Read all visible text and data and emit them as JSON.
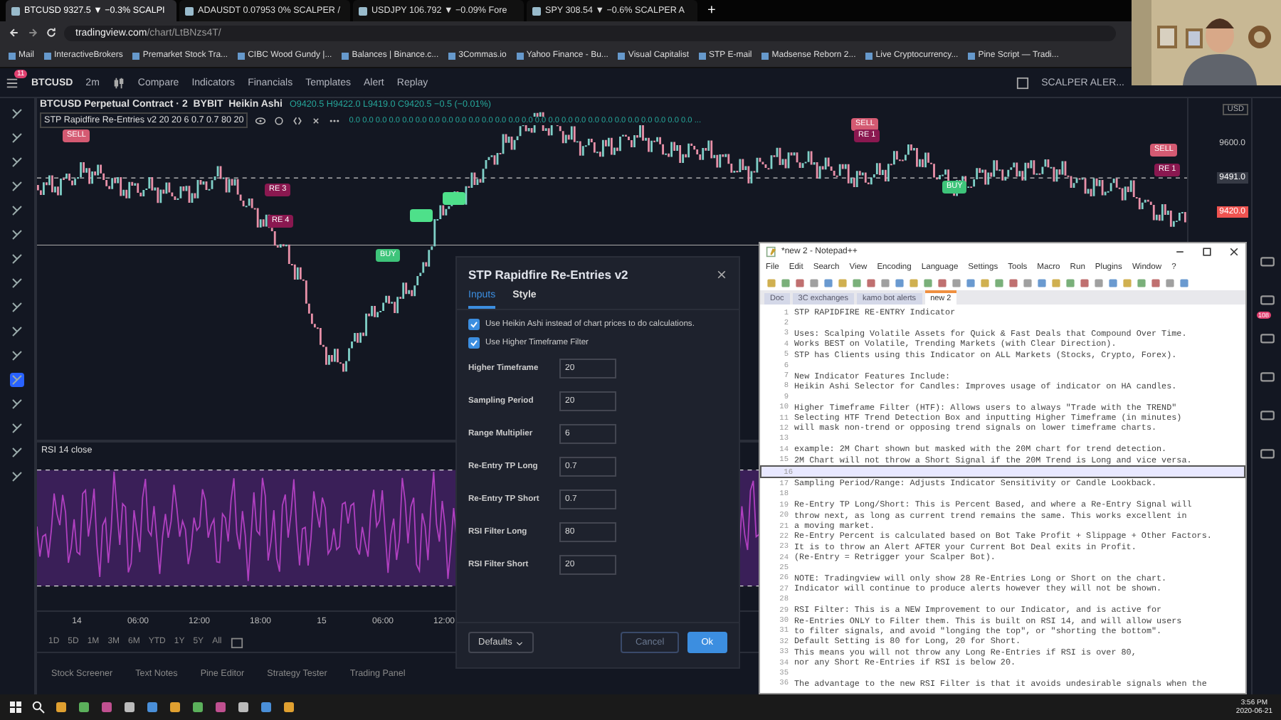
{
  "browser": {
    "tabs": [
      {
        "title": "BTCUSD 9327.5 ▼ −0.3% SCALPI",
        "selected": true
      },
      {
        "title": "ADAUSDT 0.07953 0% SCALPER /",
        "selected": false
      },
      {
        "title": "USDJPY 106.792 ▼ −0.09% Fore",
        "selected": false
      },
      {
        "title": "SPY 308.54 ▼ −0.6% SCALPER A",
        "selected": false
      }
    ],
    "new_tab": "+",
    "url_host": "tradingview.com",
    "url_path": "/chart/LtBNzs4T/",
    "bookmarks": [
      "Mail",
      "InteractiveBrokers",
      "Premarket Stock Tra...",
      "CIBC Wood Gundy |...",
      "Balances | Binance.c...",
      "3Commas.io",
      "Yahoo Finance - Bu...",
      "Visual Capitalist",
      "STP E-mail",
      "Madsense Reborn 2...",
      "Live Cryptocurrency...",
      "Pine Script — Tradi..."
    ]
  },
  "toolbar": {
    "menu_badge": "11",
    "symbol": "BTCUSD",
    "interval": "2m",
    "items": [
      "Compare",
      "Indicators",
      "Financials",
      "Templates",
      "Alert",
      "Replay"
    ],
    "layout": "SCALPER ALER..."
  },
  "chart": {
    "title": "BTCUSD Perpetual Contract · 2  BYBIT  Heikin Ashi",
    "ohlc": "O9420.5 H9422.0 L9419.0 C9420.5 −0.5 (−0.01%)",
    "indicator": "STP Rapidfire Re-Entries v2 20 20 6 0.7 0.7 80 20",
    "indicator_values": "0.0 0.0 0.0 0.0 0.0 0.0 0.0 0.0 0.0 0.0 0.0 0.0 0.0 0.0 0.0 0.0 0.0 0.0 0.0 0.0 0.0 0.0 0.0 0.0 0.0 0.0 ...",
    "signals": [
      {
        "kind": "sell",
        "label": "SELL"
      },
      {
        "kind": "short_reentry",
        "label": "RE 3"
      },
      {
        "kind": "short_reentry",
        "label": "RE 4"
      },
      {
        "kind": "buy",
        "label": "BUY"
      },
      {
        "kind": "long_reentry"
      },
      {
        "kind": "long_reentry"
      },
      {
        "kind": "sell",
        "label": "SELL"
      },
      {
        "kind": "short_reentry",
        "label": "RE 1"
      },
      {
        "kind": "buy",
        "label": "BUY"
      },
      {
        "kind": "sell",
        "label": "SELL"
      },
      {
        "kind": "short_reentry",
        "label": "RE 1"
      }
    ],
    "price_axis": {
      "currency": "USD",
      "labels": [
        {
          "text": "9600.0",
          "kind": "plain"
        },
        {
          "text": "9491.0",
          "kind": "crosshair"
        },
        {
          "text": "9420.0",
          "kind": "last"
        }
      ]
    },
    "rsi_title": "RSI 14 close",
    "time_labels": [
      "14",
      "06:00",
      "12:00",
      "18:00",
      "15",
      "06:00",
      "12:00"
    ],
    "ranges": [
      "1D",
      "5D",
      "1M",
      "3M",
      "6M",
      "YTD",
      "1Y",
      "5Y",
      "All"
    ]
  },
  "bottom_tabs": [
    "Stock Screener",
    "Text Notes",
    "Pine Editor",
    "Strategy Tester",
    "Trading Panel"
  ],
  "sidebar_badge": "108",
  "dialog": {
    "title": "STP Rapidfire Re-Entries v2",
    "tabs": [
      {
        "label": "Inputs",
        "selected": true
      },
      {
        "label": "Style",
        "selected": false
      }
    ],
    "checkboxes": [
      {
        "label": "Use Heikin Ashi instead of chart prices to do calculations.",
        "checked": true
      },
      {
        "label": "Use Higher Timeframe Filter",
        "checked": true
      }
    ],
    "fields": [
      {
        "label": "Higher Timeframe",
        "value": "20"
      },
      {
        "label": "Sampling Period",
        "value": "20"
      },
      {
        "label": "Range Multiplier",
        "value": "6"
      },
      {
        "label": "Re-Entry TP Long",
        "value": "0.7"
      },
      {
        "label": "Re-Entry TP Short",
        "value": "0.7"
      },
      {
        "label": "RSI Filter Long",
        "value": "80"
      },
      {
        "label": "RSI Filter Short",
        "value": "20"
      }
    ],
    "defaults": "Defaults",
    "cancel": "Cancel",
    "ok": "Ok"
  },
  "notepad": {
    "title": "*new 2 - Notepad++",
    "menu": [
      "File",
      "Edit",
      "Search",
      "View",
      "Encoding",
      "Language",
      "Settings",
      "Tools",
      "Macro",
      "Run",
      "Plugins",
      "Window",
      "?"
    ],
    "tabs": [
      {
        "label": "Doc",
        "selected": false
      },
      {
        "label": "3C exchanges",
        "selected": false
      },
      {
        "label": "kamo bot alerts",
        "selected": false
      },
      {
        "label": "new 2",
        "selected": true
      }
    ],
    "lines": [
      {
        "number": "1",
        "text": "STP RAPIDFIRE RE-ENTRY Indicator"
      },
      {
        "number": "2"
      },
      {
        "number": "3",
        "text": "Uses: Scalping Volatile Assets for Quick & Fast Deals that Compound Over Time."
      },
      {
        "number": "4",
        "text": "Works BEST on Volatile, Trending Markets (with Clear Direction)."
      },
      {
        "number": "5",
        "text": "STP has Clients using this Indicator on ALL Markets (Stocks, Crypto, Forex)."
      },
      {
        "number": "6"
      },
      {
        "number": "7",
        "text": "New Indicator Features Include:"
      },
      {
        "number": "8",
        "text": "Heikin Ashi Selector for Candles: Improves usage of indicator on HA candles."
      },
      {
        "number": "9"
      },
      {
        "number": "10",
        "text": "Higher Timeframe Filter (HTF): Allows users to always \"Trade with the TREND\""
      },
      {
        "number": "11",
        "text": "Selecting HTF Trend Detection Box and inputting Higher Timeframe (in minutes)"
      },
      {
        "number": "12",
        "text": "will mask non-trend or opposing trend signals on lower timeframe charts."
      },
      {
        "number": "13"
      },
      {
        "number": "14",
        "text": "example: 2M Chart shown but masked with the 20M chart for trend detection."
      },
      {
        "number": "15",
        "text": "2M Chart will not throw a Short Signal if the 20M Trend is Long and vice versa."
      },
      {
        "number": "16",
        "current": true
      },
      {
        "number": "17",
        "text": "Sampling Period/Range: Adjusts Indicator Sensitivity or Candle Lookback."
      },
      {
        "number": "18"
      },
      {
        "number": "19",
        "text": "Re-Entry TP Long/Short: This is Percent Based, and where a Re-Entry Signal will"
      },
      {
        "number": "20",
        "text": "throw next, as long as current trend remains the same. This works excellent in"
      },
      {
        "number": "21",
        "text": "a moving market."
      },
      {
        "number": "22",
        "text": "Re-Entry Percent is calculated based on Bot Take Profit + Slippage + Other Factors."
      },
      {
        "number": "23",
        "text": "It is to throw an Alert AFTER your Current Bot Deal exits in Profit."
      },
      {
        "number": "24",
        "text": "(Re-Entry = Retrigger your Scalper Bot)."
      },
      {
        "number": "25"
      },
      {
        "number": "26",
        "text": "NOTE: Tradingview will only show 28 Re-Entries Long or Short on the chart."
      },
      {
        "number": "27",
        "text": "Indicator will continue to produce alerts however they will not be shown."
      },
      {
        "number": "28"
      },
      {
        "number": "29",
        "text": "RSI Filter: This is a NEW Improvement to our Indicator, and is active for"
      },
      {
        "number": "30",
        "text": "Re-Entries ONLY to Filter them. This is built on RSI 14, and will allow users"
      },
      {
        "number": "31",
        "text": "to filter signals, and avoid \"longing the top\", or \"shorting the bottom\"."
      },
      {
        "number": "32",
        "text": "Default Setting is 80 for Long, 20 for Short."
      },
      {
        "number": "33",
        "text": "This means you will not throw any Long Re-Entries if RSI is over 80,"
      },
      {
        "number": "34",
        "text": "nor any Short Re-Entries if RSI is below 20."
      },
      {
        "number": "35"
      },
      {
        "number": "36",
        "text": "The advantage to the new RSI Filter is that it avoids undesirable signals when the"
      }
    ]
  },
  "taskbar": {
    "time": "3:56 PM",
    "date": "2020-06-21"
  }
}
